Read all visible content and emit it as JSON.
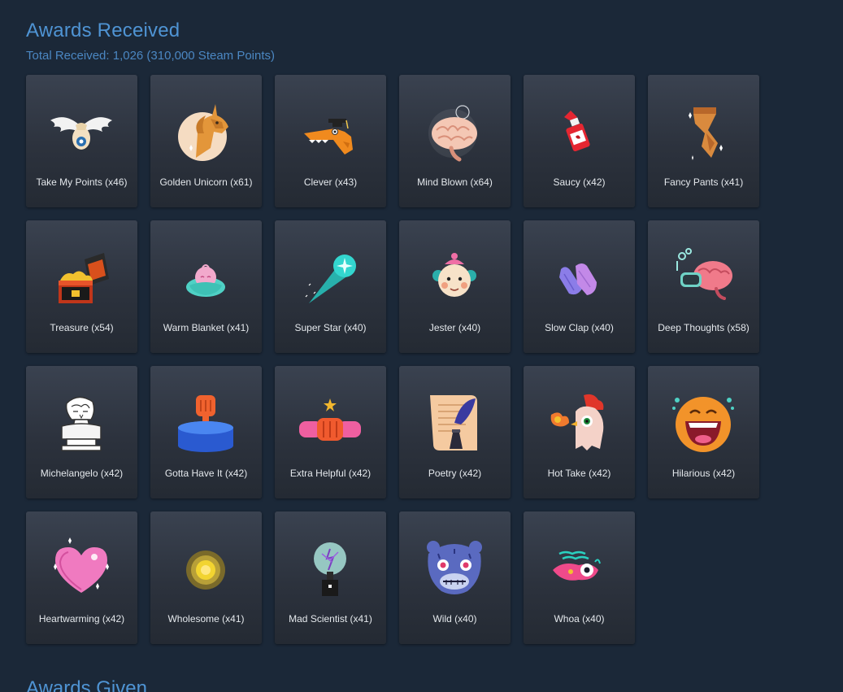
{
  "received": {
    "title": "Awards Received",
    "total_text": "Total Received: 1,026 (310,000 Steam Points)"
  },
  "awards": [
    {
      "label": "Take My Points (x46)",
      "icon": "take-my-points-icon"
    },
    {
      "label": "Golden Unicorn (x61)",
      "icon": "golden-unicorn-icon"
    },
    {
      "label": "Clever (x43)",
      "icon": "clever-icon"
    },
    {
      "label": "Mind Blown (x64)",
      "icon": "mind-blown-icon"
    },
    {
      "label": "Saucy (x42)",
      "icon": "saucy-icon"
    },
    {
      "label": "Fancy Pants (x41)",
      "icon": "fancy-pants-icon"
    },
    {
      "label": "Treasure (x54)",
      "icon": "treasure-icon"
    },
    {
      "label": "Warm Blanket (x41)",
      "icon": "warm-blanket-icon"
    },
    {
      "label": "Super Star (x40)",
      "icon": "super-star-icon"
    },
    {
      "label": "Jester (x40)",
      "icon": "jester-icon"
    },
    {
      "label": "Slow Clap (x40)",
      "icon": "slow-clap-icon"
    },
    {
      "label": "Deep Thoughts (x58)",
      "icon": "deep-thoughts-icon"
    },
    {
      "label": "Michelangelo (x42)",
      "icon": "michelangelo-icon"
    },
    {
      "label": "Gotta Have It (x42)",
      "icon": "gotta-have-it-icon"
    },
    {
      "label": "Extra Helpful (x42)",
      "icon": "extra-helpful-icon"
    },
    {
      "label": "Poetry (x42)",
      "icon": "poetry-icon"
    },
    {
      "label": "Hot Take (x42)",
      "icon": "hot-take-icon"
    },
    {
      "label": "Hilarious (x42)",
      "icon": "hilarious-icon"
    },
    {
      "label": "Heartwarming (x42)",
      "icon": "heartwarming-icon"
    },
    {
      "label": "Wholesome (x41)",
      "icon": "wholesome-icon"
    },
    {
      "label": "Mad Scientist (x41)",
      "icon": "mad-scientist-icon"
    },
    {
      "label": "Wild (x40)",
      "icon": "wild-icon"
    },
    {
      "label": "Whoa (x40)",
      "icon": "whoa-icon"
    }
  ],
  "given": {
    "title": "Awards Given"
  },
  "colors": {
    "background": "#1b2838",
    "heading": "#4f94d4",
    "card_top": "#3a4250",
    "card_bottom": "#242a33",
    "label": "#e4e8ec"
  }
}
